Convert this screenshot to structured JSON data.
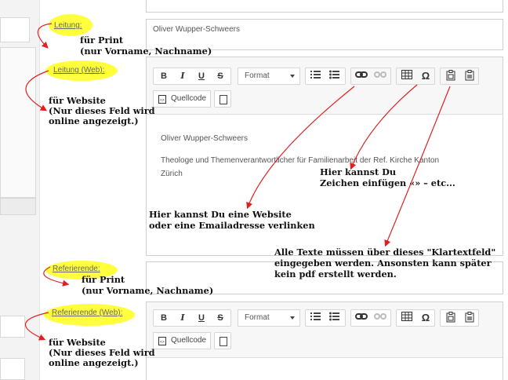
{
  "fields": {
    "leitung_label": "Leitung:",
    "leitung_value": "Oliver Wupper-Schweers",
    "leitung_web_label": "Leitung (Web):",
    "referierende_label": "Referierende:",
    "referierende_web_label": "Referierende (Web):"
  },
  "toolbar": {
    "bold": "B",
    "italic": "I",
    "underline": "U",
    "strike": "S",
    "format": "Format",
    "omega": "Ω",
    "source": "Quellcode"
  },
  "editor1": {
    "line1": "Oliver Wupper-Schweers",
    "line2": "Theologe und Themenverantwortlicher für Familienarbeit der Ref. Kirche Kanton",
    "line3": "Zürich"
  },
  "annotations": {
    "print1_a": "für Print",
    "print1_b": "(nur Vorname, Nachname)",
    "web1_a": "für Website",
    "web1_b": "(Nur dieses Feld wird",
    "web1_c": "online angezeigt.)",
    "char_a": "Hier kannst Du",
    "char_b": "Zeichen einfügen «» – etc...",
    "link_a": "Hier kannst Du eine Website",
    "link_b": "oder eine Emailadresse verlinken",
    "plain_a": "Alle Texte müssen über dieses \"Klartextfeld\"",
    "plain_b": "eingegeben werden. Ansonsten kann später",
    "plain_c": "kein pdf erstellt werden.",
    "print2_a": "für Print",
    "print2_b": "(nur Vorname, Nachname)",
    "web2_a": "für Website",
    "web2_b": "(Nur dieses Feld wird",
    "web2_c": "online angezeigt.)"
  },
  "colors": {
    "highlight": "#ffff33",
    "arrow": "#e02020"
  },
  "icons": [
    "link-icon",
    "unlink-icon",
    "table-icon",
    "omega-icon",
    "paste-text-icon",
    "paste-word-icon",
    "numbered-list-icon",
    "bullet-list-icon",
    "source-icon",
    "document-icon"
  ]
}
